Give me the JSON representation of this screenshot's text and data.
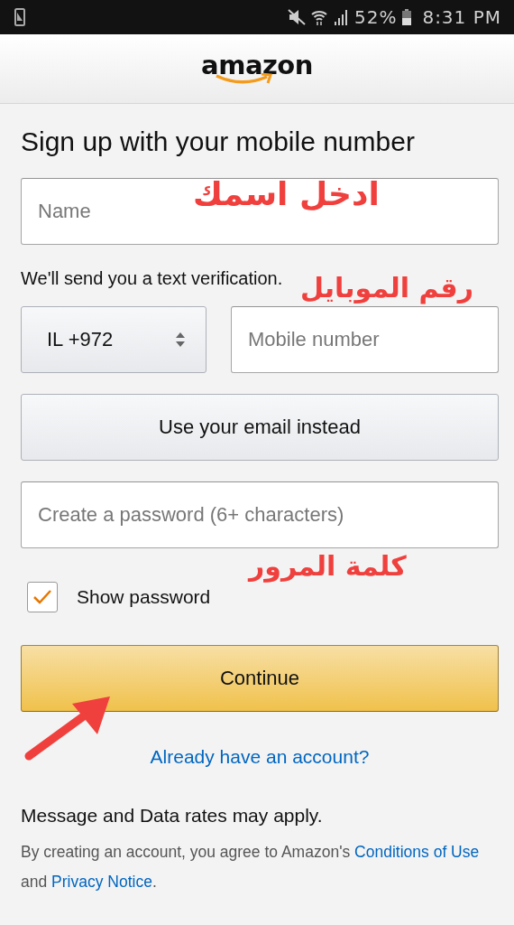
{
  "status_bar": {
    "battery_text": "52%",
    "time": "8:31 PM"
  },
  "header": {
    "logo": "amazon"
  },
  "form": {
    "title": "Sign up with your mobile number",
    "name_field": {
      "placeholder": "Name"
    },
    "note": "We'll send you a text verification.",
    "country_select": {
      "value": "IL +972"
    },
    "mobile_field": {
      "placeholder": "Mobile number"
    },
    "email_button": "Use your email instead",
    "password_field": {
      "placeholder": "Create a password (6+ characters)"
    },
    "show_password": {
      "label": "Show password",
      "checked": true
    },
    "continue_button": "Continue",
    "signin_link": "Already have an account?",
    "rates_note": "Message and Data rates may apply.",
    "legal": {
      "text": "By creating an account, you agree to Amazon's",
      "conditions_link": "Conditions of Use",
      "joiner": "and",
      "privacy_link": "Privacy Notice",
      "end": "."
    }
  },
  "annotations": [
    {
      "text": "ادخل اسمك"
    },
    {
      "text": "رقم الموبايل"
    },
    {
      "text": "كلمة المرور"
    }
  ]
}
